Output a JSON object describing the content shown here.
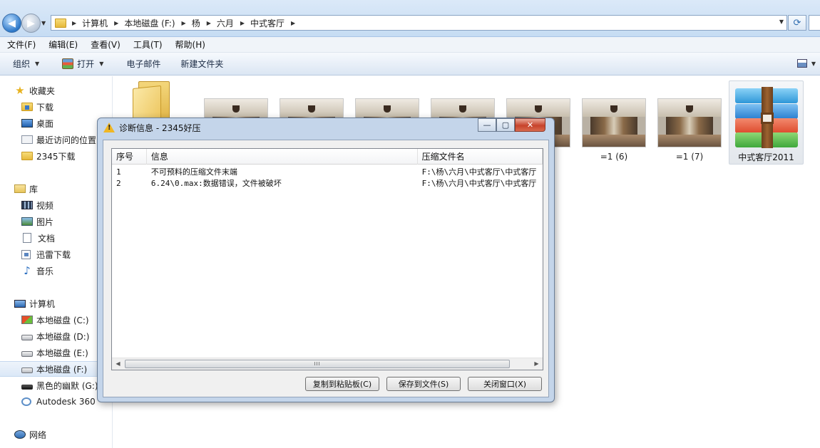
{
  "address_bar": {
    "breadcrumbs": [
      "计算机",
      "本地磁盘 (F:)",
      "杨",
      "六月",
      "中式客厅"
    ]
  },
  "menu": [
    "文件(F)",
    "编辑(E)",
    "查看(V)",
    "工具(T)",
    "帮助(H)"
  ],
  "commands": {
    "organize": "组织",
    "open": "打开",
    "email": "电子邮件",
    "new_folder": "新建文件夹"
  },
  "nav": {
    "favorites": {
      "header": "收藏夹",
      "items": [
        "下载",
        "桌面",
        "最近访问的位置",
        "2345下载"
      ]
    },
    "libraries": {
      "header": "库",
      "items": [
        "视频",
        "图片",
        "文档",
        "迅雷下载",
        "音乐"
      ]
    },
    "computer": {
      "header": "计算机",
      "items": [
        "本地磁盘 (C:)",
        "本地磁盘 (D:)",
        "本地磁盘 (E:)",
        "本地磁盘 (F:)",
        "黑色的幽默 (G:)",
        "Autodesk 360"
      ]
    },
    "network": {
      "header": "网络"
    }
  },
  "files": {
    "thumb_labels": [
      "=1 (6)",
      "=1 (7)"
    ],
    "archive_label": "中式客厅2011"
  },
  "dialog": {
    "title": "诊断信息 - 2345好压",
    "window_buttons": {
      "minimize": "—",
      "maximize": "▢",
      "close": "✕"
    },
    "columns": [
      "序号",
      "信息",
      "压缩文件名"
    ],
    "rows": [
      {
        "num": "1",
        "info": "不可预料的压缩文件末端",
        "archive": "F:\\杨\\六月\\中式客厅\\中式客厅"
      },
      {
        "num": "2",
        "info": "6.24\\0.max:数据错误，文件被破坏",
        "archive": "F:\\杨\\六月\\中式客厅\\中式客厅"
      }
    ],
    "scroll_grip": "III",
    "buttons": {
      "copy": "复制到粘贴板(C)",
      "save": "保存到文件(S)",
      "close": "关闭窗口(X)"
    }
  }
}
